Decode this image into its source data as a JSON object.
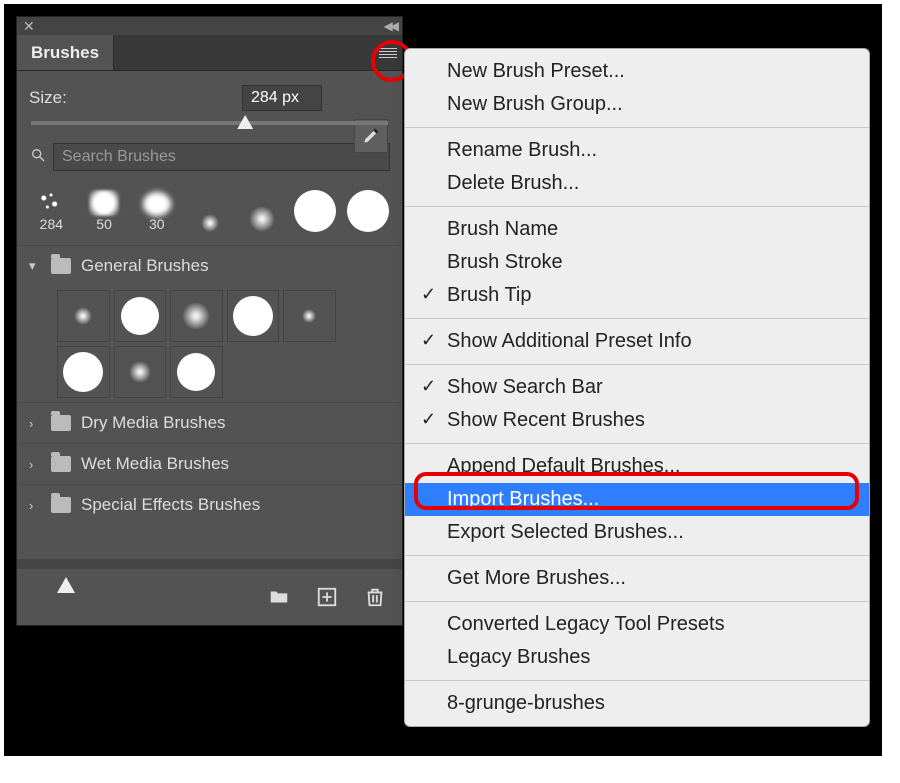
{
  "panel": {
    "title": "Brushes",
    "size_label": "Size:",
    "size_value": "284 px",
    "search_placeholder": "Search Brushes",
    "slider_percent": 60,
    "recent_brushes": [
      {
        "label": "284",
        "type": "tex1"
      },
      {
        "label": "50",
        "type": "tex2"
      },
      {
        "label": "30",
        "type": "tex3"
      },
      {
        "label": "",
        "type": "soft-sm"
      },
      {
        "label": "",
        "type": "soft-md"
      },
      {
        "label": "",
        "type": "hard-lg"
      },
      {
        "label": "",
        "type": "hard-lg"
      }
    ],
    "folders": [
      {
        "name": "General Brushes",
        "expanded": true
      },
      {
        "name": "Dry Media Brushes",
        "expanded": false
      },
      {
        "name": "Wet Media Brushes",
        "expanded": false
      },
      {
        "name": "Special Effects Brushes",
        "expanded": false
      }
    ]
  },
  "menu": {
    "groups": [
      [
        {
          "label": "New Brush Preset...",
          "checked": false
        },
        {
          "label": "New Brush Group...",
          "checked": false
        }
      ],
      [
        {
          "label": "Rename Brush...",
          "checked": false
        },
        {
          "label": "Delete Brush...",
          "checked": false
        }
      ],
      [
        {
          "label": "Brush Name",
          "checked": false
        },
        {
          "label": "Brush Stroke",
          "checked": false
        },
        {
          "label": "Brush Tip",
          "checked": true
        }
      ],
      [
        {
          "label": "Show Additional Preset Info",
          "checked": true
        }
      ],
      [
        {
          "label": "Show Search Bar",
          "checked": true
        },
        {
          "label": "Show Recent Brushes",
          "checked": true
        }
      ],
      [
        {
          "label": "Append Default Brushes...",
          "checked": false
        },
        {
          "label": "Import Brushes...",
          "checked": false,
          "selected": true
        },
        {
          "label": "Export Selected Brushes...",
          "checked": false
        }
      ],
      [
        {
          "label": "Get More Brushes...",
          "checked": false
        }
      ],
      [
        {
          "label": "Converted Legacy Tool Presets",
          "checked": false
        },
        {
          "label": "Legacy Brushes",
          "checked": false
        }
      ],
      [
        {
          "label": "8-grunge-brushes",
          "checked": false
        }
      ]
    ]
  },
  "annotations": {
    "circle": "flyout-button",
    "box": "Import Brushes..."
  },
  "colors": {
    "highlight": "#2e7eff",
    "annotation": "#e60000",
    "panel_bg": "#535353"
  }
}
